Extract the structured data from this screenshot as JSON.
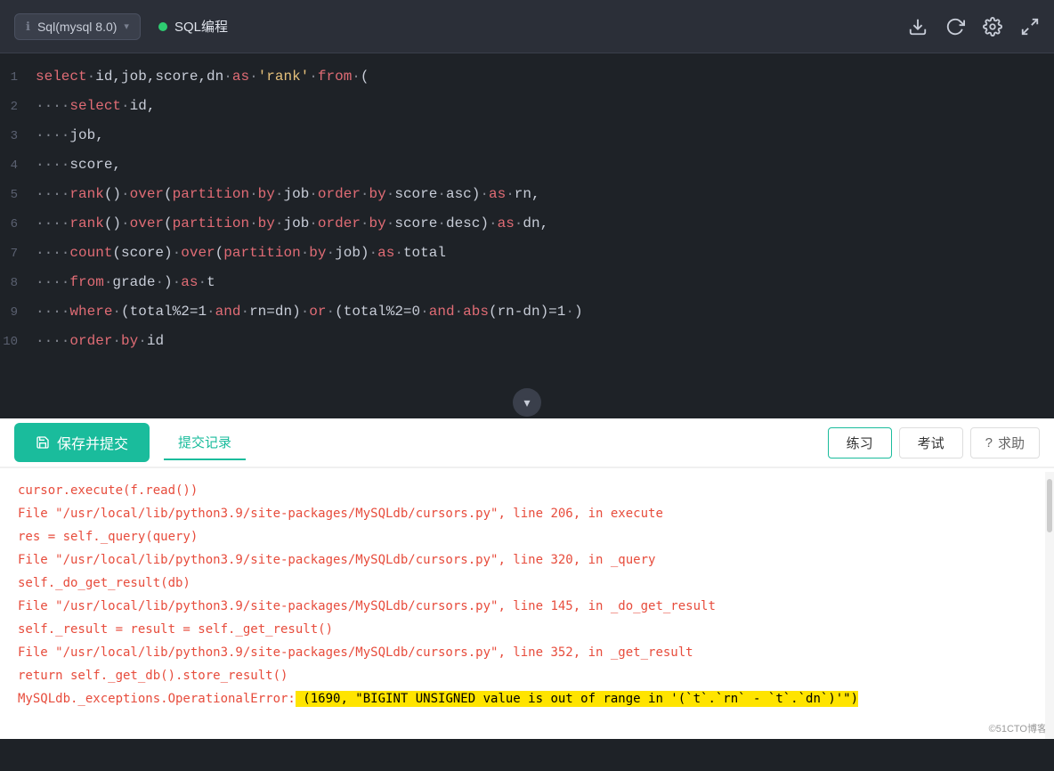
{
  "topbar": {
    "db_selector": "Sql(mysql 8.0)",
    "db_info_icon": "ℹ",
    "db_chevron": "▾",
    "sql_label": "SQL编程",
    "download_icon": "⬇",
    "refresh_icon": "↻",
    "settings_icon": "⚙",
    "fullscreen_icon": "⛶"
  },
  "editor": {
    "lines": [
      {
        "num": 1,
        "text": "select·id,job,score,dn·as·'rank'·from·("
      },
      {
        "num": 2,
        "text": "····select·id,"
      },
      {
        "num": 3,
        "text": "····job,"
      },
      {
        "num": 4,
        "text": "····score,"
      },
      {
        "num": 5,
        "text": "····rank()·over(partition·by·job·order·by·score·asc)·as·rn,"
      },
      {
        "num": 6,
        "text": "····rank()·over(partition·by·job·order·by·score·desc)·as·dn,"
      },
      {
        "num": 7,
        "text": "····count(score)·over(partition·by·job)·as·total"
      },
      {
        "num": 8,
        "text": "····from·grade·)·as·t"
      },
      {
        "num": 9,
        "text": "····where·(total%2=1·and·rn=dn)·or·(total%2=0·and·abs(rn-dn)=1·)"
      },
      {
        "num": 10,
        "text": "····order·by·id"
      }
    ]
  },
  "collapse_btn": "▾",
  "bottom": {
    "submit_btn": "保存并提交",
    "tab_active": "提交记录",
    "right_tab1": "练习",
    "right_tab2": "考试",
    "help_btn": "求助",
    "help_icon": "?"
  },
  "errors": [
    {
      "text": "cursor.execute(f.read())",
      "highlight": false
    },
    {
      "text": "File \"/usr/local/lib/python3.9/site-packages/MySQLdb/cursors.py\", line 206, in execute",
      "highlight": false
    },
    {
      "text": "res = self._query(query)",
      "highlight": false
    },
    {
      "text": "File \"/usr/local/lib/python3.9/site-packages/MySQLdb/cursors.py\", line 320, in _query",
      "highlight": false
    },
    {
      "text": "self._do_get_result(db)",
      "highlight": false
    },
    {
      "text": "File \"/usr/local/lib/python3.9/site-packages/MySQLdb/cursors.py\", line 145, in _do_get_result",
      "highlight": false
    },
    {
      "text": "self._result = result = self._get_result()",
      "highlight": false
    },
    {
      "text": "File \"/usr/local/lib/python3.9/site-packages/MySQLdb/cursors.py\", line 352, in _get_result",
      "highlight": false
    },
    {
      "text": "return self._get_db().store_result()",
      "highlight": false
    },
    {
      "text_before": "MySQLdb._exceptions.OperationalError:",
      "text_highlighted": "(1690, \"BIGINT UNSIGNED value is out of range in '(`t`.`rn` - `t`.`dn`)'\")",
      "highlight": true
    }
  ],
  "watermark": "©51CTO博客"
}
